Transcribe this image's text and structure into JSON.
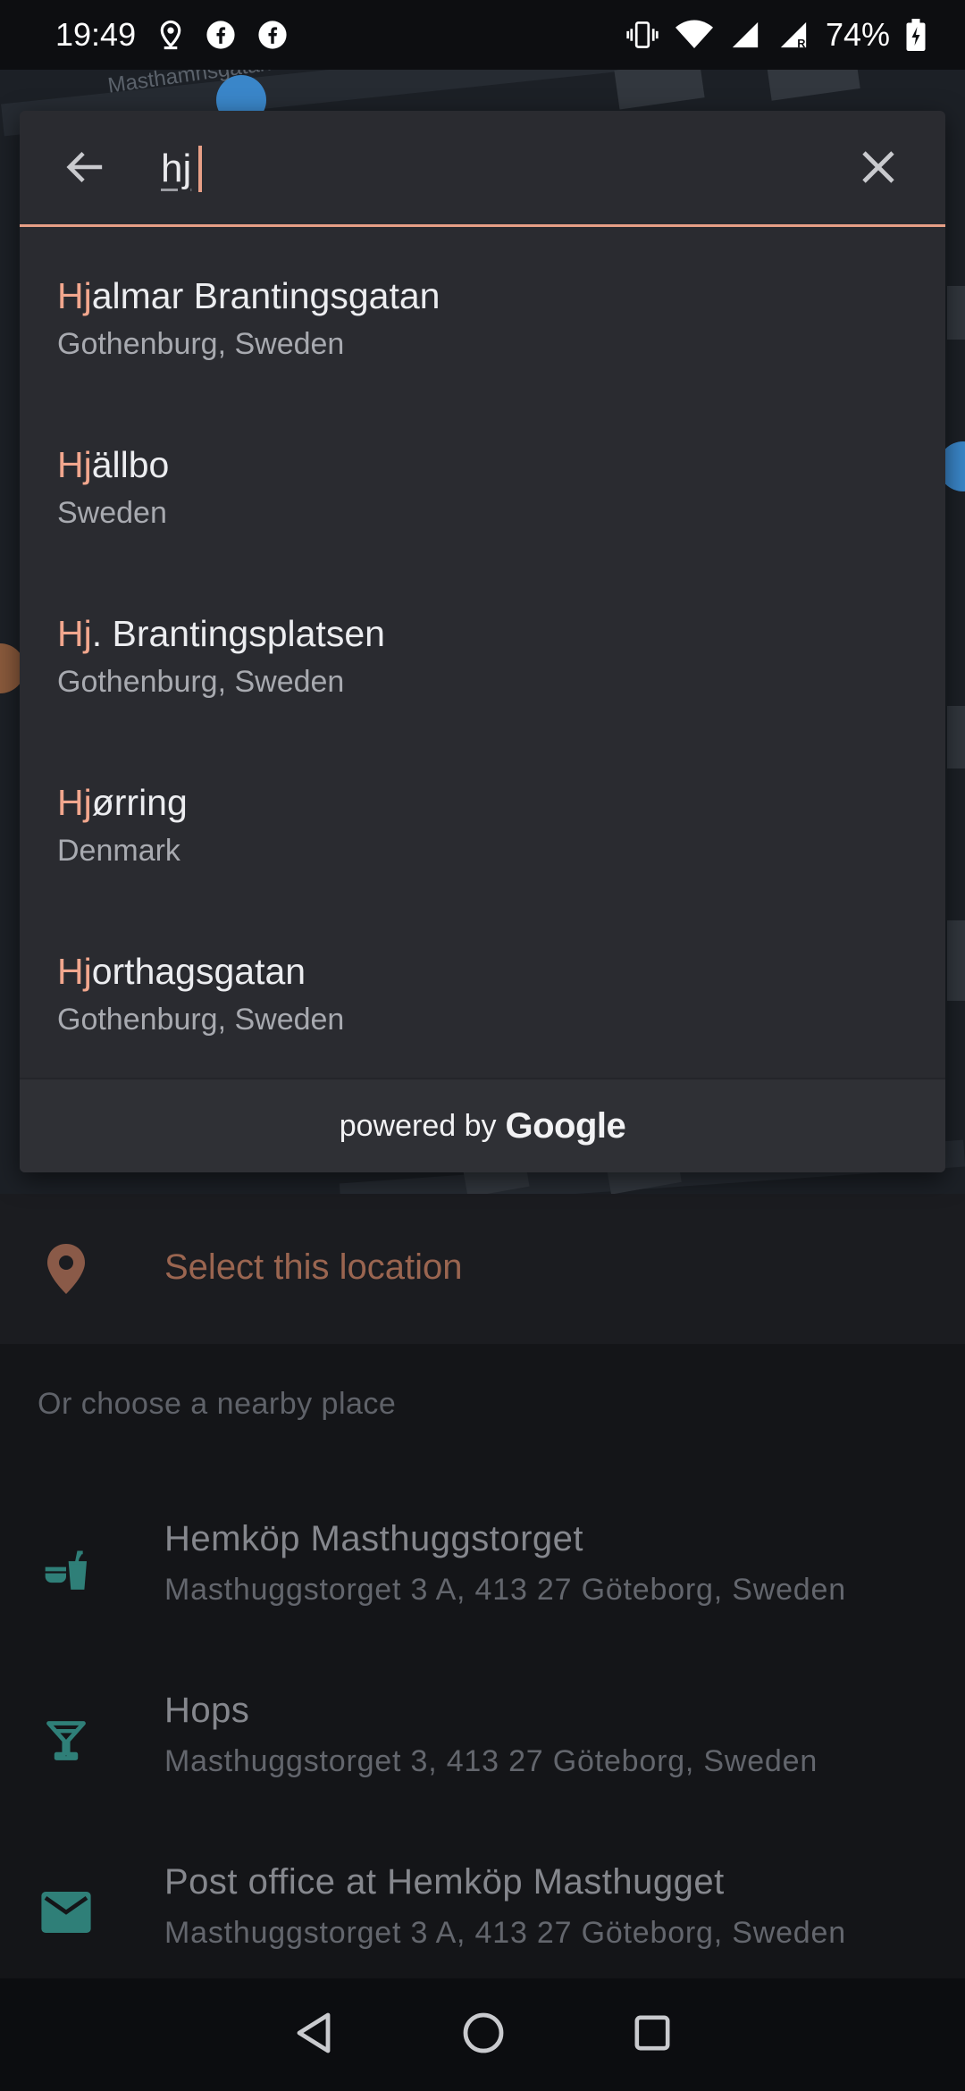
{
  "status_bar": {
    "time": "19:49",
    "battery": "74%",
    "icons": [
      "location-icon",
      "facebook-icon",
      "facebook-icon",
      "vibrate-icon",
      "wifi-icon",
      "signal-icon",
      "signal-roaming-icon",
      "battery-charging-icon"
    ]
  },
  "map": {
    "street_label": "Masthamnsgatan"
  },
  "search": {
    "query": "hj",
    "back_icon": "arrow-back-icon",
    "clear_icon": "close-icon",
    "underline_color": "#e79f86",
    "results": [
      {
        "highlight": "Hj",
        "rest": "almar Brantingsgatan",
        "sub": "Gothenburg, Sweden"
      },
      {
        "highlight": "Hj",
        "rest": "ällbo",
        "sub": "Sweden"
      },
      {
        "highlight": "Hj",
        "rest": ". Brantingsplatsen",
        "sub": "Gothenburg, Sweden"
      },
      {
        "highlight": "Hj",
        "rest": "ørring",
        "sub": "Denmark"
      },
      {
        "highlight": "Hj",
        "rest": "orthagsgatan",
        "sub": "Gothenburg, Sweden"
      }
    ],
    "attribution_prefix": "powered by",
    "attribution_brand": "Google"
  },
  "sheet": {
    "select_label": "Select this location",
    "select_icon": "location-pin-icon",
    "nearby_title": "Or choose a nearby place",
    "places": [
      {
        "icon": "grocery-icon",
        "name": "Hemköp Masthuggstorget",
        "address": "Masthuggstorget 3 A, 413 27 Göteborg, Sweden"
      },
      {
        "icon": "cocktail-bar-icon",
        "name": "Hops",
        "address": "Masthuggstorget 3, 413 27 Göteborg, Sweden"
      },
      {
        "icon": "mail-icon",
        "name": "Post office at Hemköp Masthugget",
        "address": "Masthuggstorget 3 A, 413 27 Göteborg, Sweden"
      }
    ]
  },
  "nav_bar": {
    "buttons": [
      "back-nav-icon",
      "home-nav-icon",
      "recents-nav-icon"
    ]
  },
  "colors": {
    "accent": "#e79f86",
    "highlight_text": "#f2a78e",
    "select_label": "#9a6550",
    "place_icon": "#2f7f78",
    "card_bg": "#2a2b30"
  }
}
